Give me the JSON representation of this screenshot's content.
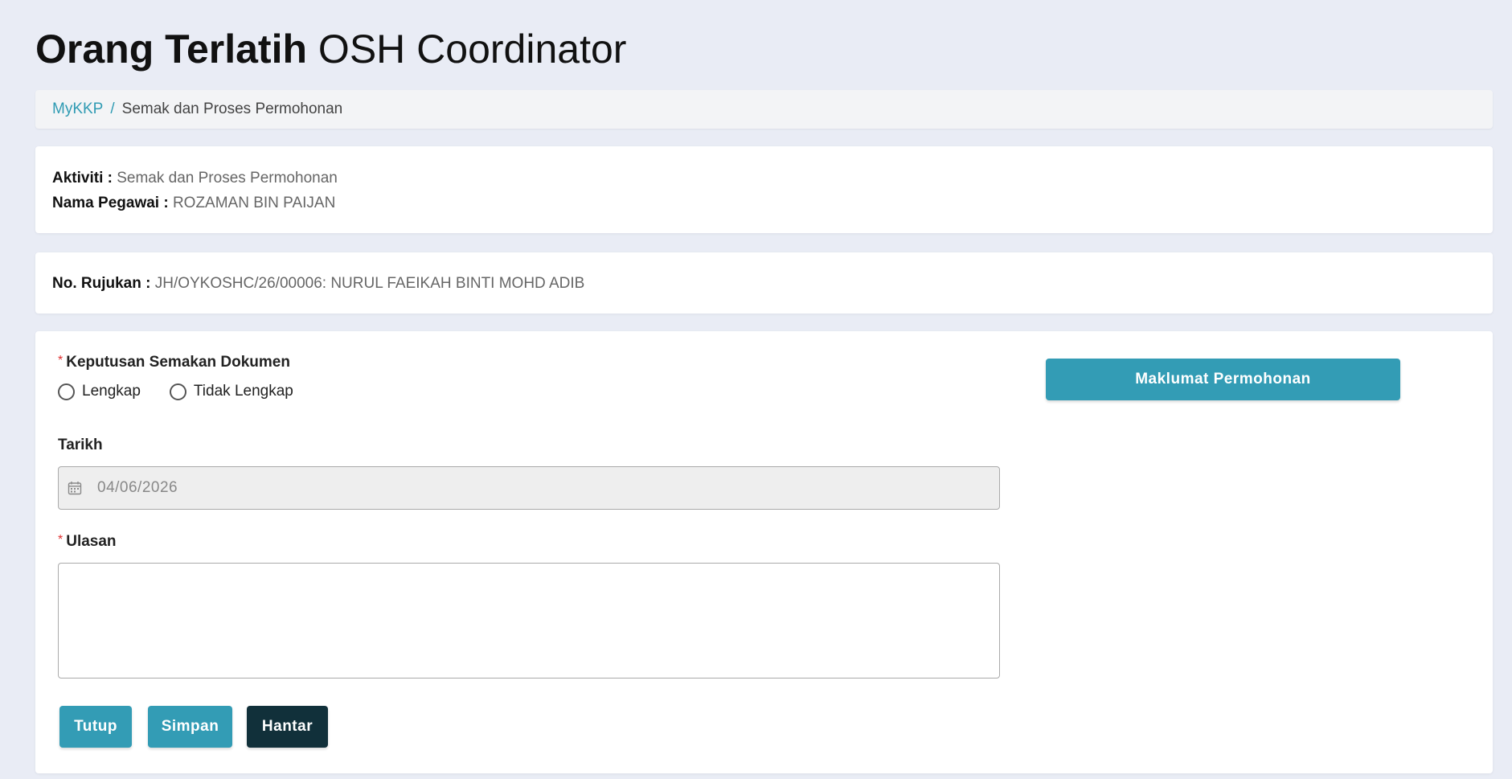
{
  "header": {
    "title_bold": "Orang Terlatih",
    "title_light": "OSH Coordinator"
  },
  "breadcrumb": {
    "root": "MyKKP",
    "separator": "/",
    "current": "Semak dan Proses Permohonan"
  },
  "info": {
    "activity_label": "Aktiviti :",
    "activity_value": "Semak dan Proses Permohonan",
    "officer_label": "Nama Pegawai :",
    "officer_value": "ROZAMAN BIN PAIJAN"
  },
  "reference": {
    "label": "No. Rujukan :",
    "value": "JH/OYKOSHC/26/00006: NURUL FAEIKAH BINTI MOHD ADIB"
  },
  "form": {
    "required_mark": "*",
    "decision_label": "Keputusan Semakan Dokumen",
    "decision_options": [
      "Lengkap",
      "Tidak Lengkap"
    ],
    "date_label": "Tarikh",
    "date_value": "04/06/2026",
    "remarks_label": "Ulasan",
    "remarks_value": ""
  },
  "actions": {
    "close": "Tutup",
    "save": "Simpan",
    "submit": "Hantar",
    "application_info": "Maklumat Permohonan"
  },
  "icons": {
    "date": "calendar-icon",
    "radio": "radio-circle"
  },
  "colors": {
    "background": "#e9ecf5",
    "primary": "#339cb5",
    "dark": "#11303a",
    "link": "#2f9bb3",
    "required": "#e03131"
  }
}
